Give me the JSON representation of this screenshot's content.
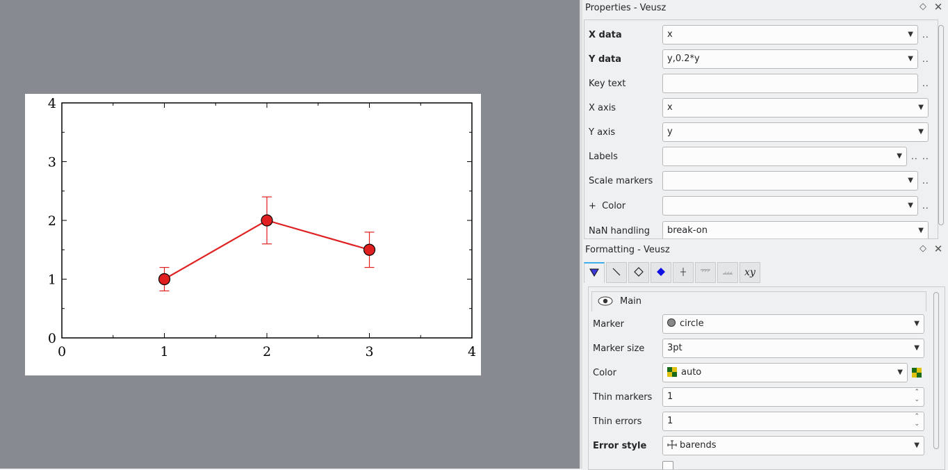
{
  "chart_data": {
    "type": "scatter",
    "x": [
      1,
      2,
      3
    ],
    "y": [
      1,
      2,
      1.5
    ],
    "y_err": [
      0.2,
      0.4,
      0.3
    ],
    "xlim": [
      0,
      4
    ],
    "ylim": [
      0,
      4
    ],
    "x_ticks": [
      "0",
      "1",
      "2",
      "3",
      "4"
    ],
    "y_ticks": [
      "0",
      "1",
      "2",
      "3",
      "4"
    ],
    "title": "",
    "xlabel": "",
    "ylabel": "",
    "marker": "circle",
    "line": true,
    "color": "#e02020",
    "grid": false
  },
  "properties": {
    "title": "Properties - Veusz",
    "rows": {
      "x_data": {
        "label": "X data",
        "value": "x"
      },
      "y_data": {
        "label": "Y data",
        "value": "y,0.2*y"
      },
      "key_text": {
        "label": "Key text",
        "value": ""
      },
      "x_axis": {
        "label": "X axis",
        "value": "x"
      },
      "y_axis": {
        "label": "Y axis",
        "value": "y"
      },
      "labels": {
        "label": "Labels",
        "value": ""
      },
      "scale_markers": {
        "label": "Scale markers",
        "value": ""
      },
      "color": {
        "label": "+  Color",
        "value": ""
      },
      "nan_handling": {
        "label": "NaN handling",
        "value": "break-on"
      }
    }
  },
  "formatting": {
    "title": "Formatting - Veusz",
    "tab_icons": [
      "marker-icon",
      "line-icon",
      "diamond-icon",
      "fill-icon",
      "errorbar-icon",
      "fill-above-icon",
      "fill-below-icon",
      "label-icon"
    ],
    "tab_xy_label": "xy",
    "main_label": "Main",
    "rows": {
      "marker": {
        "label": "Marker",
        "value": "circle"
      },
      "marker_size": {
        "label": "Marker size",
        "value": "3pt"
      },
      "color": {
        "label": "Color",
        "value": "auto"
      },
      "thin_markers": {
        "label": "Thin markers",
        "value": "1"
      },
      "thin_errors": {
        "label": "Thin errors",
        "value": "1"
      },
      "error_style": {
        "label": "Error style",
        "value": "barends"
      }
    }
  }
}
